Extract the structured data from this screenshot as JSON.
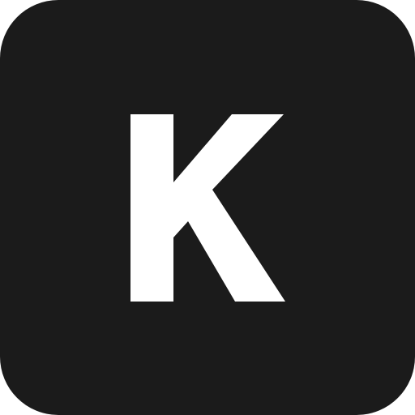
{
  "tile": {
    "letter": "K",
    "background_color": "#1b1b1b",
    "letter_color": "#ffffff"
  }
}
